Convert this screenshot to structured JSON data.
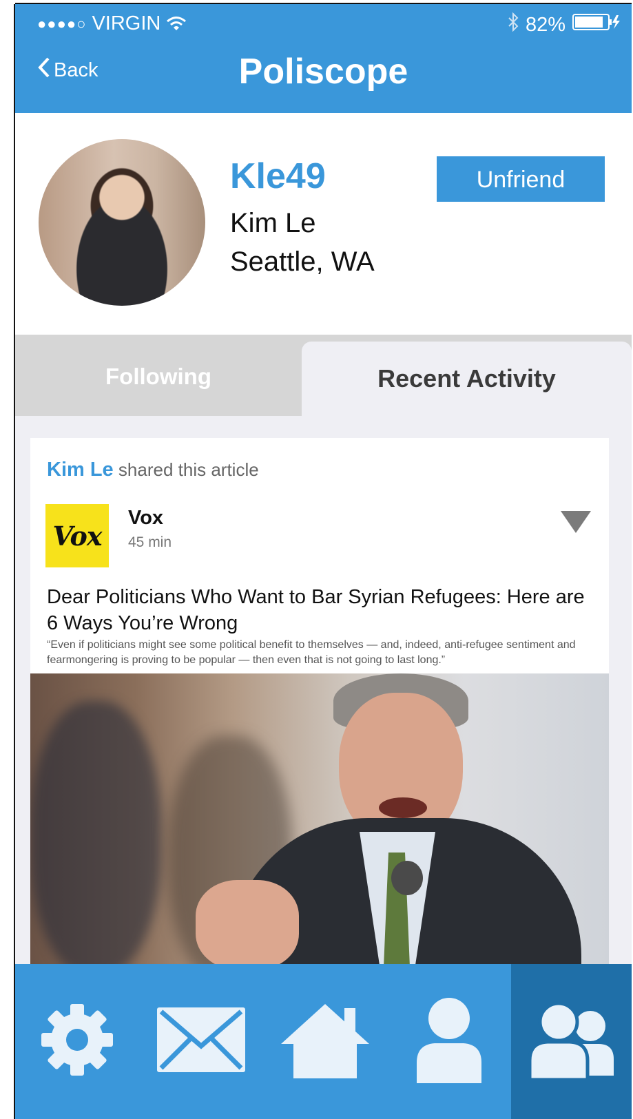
{
  "status_bar": {
    "signal": "●●●●○",
    "carrier": "VIRGIN",
    "battery": "82%"
  },
  "nav": {
    "back_label": "Back",
    "title": "Poliscope"
  },
  "profile": {
    "username": "Kle49",
    "name": "Kim Le",
    "location": "Seattle, WA",
    "unfriend_label": "Unfriend"
  },
  "tabs": [
    {
      "label": "Following",
      "active": false
    },
    {
      "label": "Recent Activity",
      "active": true
    }
  ],
  "post": {
    "sharer": "Kim Le",
    "action": "shared this article",
    "source_logo": "Vox",
    "source_name": "Vox",
    "time": "45 min",
    "headline": "Dear Politicians Who Want to Bar Syrian Refugees: Here are 6 Ways You’re Wrong",
    "quote": "“Even if politicians might see some political benefit to themselves — and, indeed, anti-refugee sentiment and fearmongering is proving to be popular — then even that is not going to last long.”"
  },
  "tab_bar": [
    {
      "icon": "gear-icon",
      "active": false
    },
    {
      "icon": "mail-icon",
      "active": false
    },
    {
      "icon": "home-icon",
      "active": false
    },
    {
      "icon": "user-icon",
      "active": false
    },
    {
      "icon": "users-icon",
      "active": true
    }
  ],
  "colors": {
    "accent": "#3a97da",
    "active_tab": "#1f6fa8",
    "logo_yellow": "#f7e21b"
  }
}
